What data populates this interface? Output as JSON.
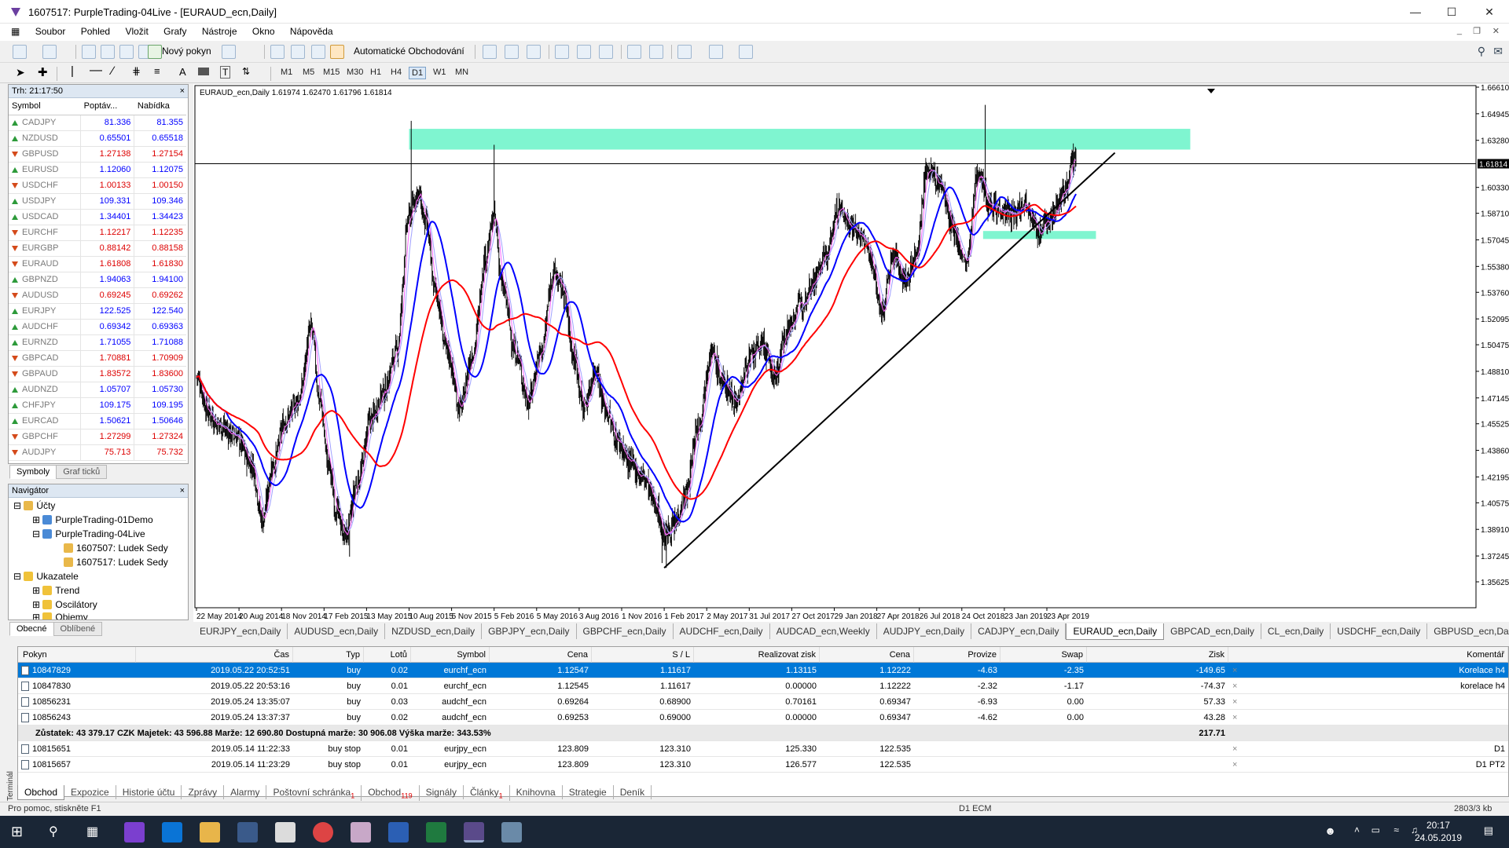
{
  "window": {
    "title": "1607517: PurpleTrading-04Live - [EURAUD_ecn,Daily]"
  },
  "menu": [
    "Soubor",
    "Pohled",
    "Vložit",
    "Grafy",
    "Nástroje",
    "Okno",
    "Nápověda"
  ],
  "toolbar": {
    "new_order": "Nový pokyn",
    "auto_trading": "Automatické Obchodování"
  },
  "timeframes": [
    "M1",
    "M5",
    "M15",
    "M30",
    "H1",
    "H4",
    "D1",
    "W1",
    "MN"
  ],
  "selected_timeframe": "D1",
  "market_watch": {
    "header": "Trh: 21:17:50",
    "columns": [
      "Symbol",
      "Poptáv...",
      "Nabídka"
    ],
    "rows": [
      {
        "symbol": "CADJPY",
        "bid": "81.336",
        "ask": "81.355",
        "dir": "up"
      },
      {
        "symbol": "NZDUSD",
        "bid": "0.65501",
        "ask": "0.65518",
        "dir": "up"
      },
      {
        "symbol": "GBPUSD",
        "bid": "1.27138",
        "ask": "1.27154",
        "dir": "dn"
      },
      {
        "symbol": "EURUSD",
        "bid": "1.12060",
        "ask": "1.12075",
        "dir": "up"
      },
      {
        "symbol": "USDCHF",
        "bid": "1.00133",
        "ask": "1.00150",
        "dir": "dn"
      },
      {
        "symbol": "USDJPY",
        "bid": "109.331",
        "ask": "109.346",
        "dir": "up"
      },
      {
        "symbol": "USDCAD",
        "bid": "1.34401",
        "ask": "1.34423",
        "dir": "up"
      },
      {
        "symbol": "EURCHF",
        "bid": "1.12217",
        "ask": "1.12235",
        "dir": "dn"
      },
      {
        "symbol": "EURGBP",
        "bid": "0.88142",
        "ask": "0.88158",
        "dir": "dn"
      },
      {
        "symbol": "EURAUD",
        "bid": "1.61808",
        "ask": "1.61830",
        "dir": "dn"
      },
      {
        "symbol": "GBPNZD",
        "bid": "1.94063",
        "ask": "1.94100",
        "dir": "up"
      },
      {
        "symbol": "AUDUSD",
        "bid": "0.69245",
        "ask": "0.69262",
        "dir": "dn"
      },
      {
        "symbol": "EURJPY",
        "bid": "122.525",
        "ask": "122.540",
        "dir": "up"
      },
      {
        "symbol": "AUDCHF",
        "bid": "0.69342",
        "ask": "0.69363",
        "dir": "up"
      },
      {
        "symbol": "EURNZD",
        "bid": "1.71055",
        "ask": "1.71088",
        "dir": "up"
      },
      {
        "symbol": "GBPCAD",
        "bid": "1.70881",
        "ask": "1.70909",
        "dir": "dn"
      },
      {
        "symbol": "GBPAUD",
        "bid": "1.83572",
        "ask": "1.83600",
        "dir": "dn"
      },
      {
        "symbol": "AUDNZD",
        "bid": "1.05707",
        "ask": "1.05730",
        "dir": "up"
      },
      {
        "symbol": "CHFJPY",
        "bid": "109.175",
        "ask": "109.195",
        "dir": "up"
      },
      {
        "symbol": "EURCAD",
        "bid": "1.50621",
        "ask": "1.50646",
        "dir": "up"
      },
      {
        "symbol": "GBPCHF",
        "bid": "1.27299",
        "ask": "1.27324",
        "dir": "dn"
      },
      {
        "symbol": "AUDJPY",
        "bid": "75.713",
        "ask": "75.732",
        "dir": "dn"
      }
    ],
    "tabs": [
      "Symboly",
      "Graf ticků"
    ]
  },
  "navigator": {
    "header": "Navigátor",
    "accounts": "Účty",
    "demo": "PurpleTrading-01Demo",
    "live": "PurpleTrading-04Live",
    "acc1": "1607507: Ludek Sedy",
    "acc2": "1607517: Ludek Sedy",
    "indicators": "Ukazatele",
    "trend": "Trend",
    "osc": "Oscilátory",
    "vol": "Objemy",
    "tabs": [
      "Obecné",
      "Oblíbené"
    ]
  },
  "chart": {
    "header": "EURAUD_ecn,Daily  1.61974 1.62470 1.61796 1.61814",
    "price_labels": [
      "1.66610",
      "1.64945",
      "1.63280",
      "1.61814",
      "1.60330",
      "1.58710",
      "1.57045",
      "1.55380",
      "1.53760",
      "1.52095",
      "1.50475",
      "1.48810",
      "1.47145",
      "1.45525",
      "1.43860",
      "1.42195",
      "1.40575",
      "1.38910",
      "1.37245",
      "1.35625"
    ],
    "current_price": "1.61814",
    "date_labels": [
      "22 May 2014",
      "20 Aug 2014",
      "18 Nov 2014",
      "17 Feb 2015",
      "13 May 2015",
      "10 Aug 2015",
      "5 Nov 2015",
      "5 Feb 2016",
      "5 May 2016",
      "3 Aug 2016",
      "1 Nov 2016",
      "1 Feb 2017",
      "2 May 2017",
      "31 Jul 2017",
      "27 Oct 2017",
      "29 Jan 2018",
      "27 Apr 2018",
      "26 Jul 2018",
      "24 Oct 2018",
      "23 Jan 2019",
      "23 Apr 2019"
    ],
    "tabs": [
      "EURJPY_ecn,Daily",
      "AUDUSD_ecn,Daily",
      "NZDUSD_ecn,Daily",
      "GBPJPY_ecn,Daily",
      "GBPCHF_ecn,Daily",
      "AUDCHF_ecn,Daily",
      "AUDCAD_ecn,Weekly",
      "AUDJPY_ecn,Daily",
      "CADJPY_ecn,Daily",
      "EURAUD_ecn,Daily",
      "GBPCAD_ecn,Daily",
      "CL_ecn,Daily",
      "USDCHF_ecn,Daily",
      "GBPUSD_ecn,Daily"
    ],
    "active_tab": "EURAUD_ecn,Daily"
  },
  "terminal": {
    "columns": [
      "Pokyn",
      "Čas",
      "Typ",
      "Lotů",
      "Symbol",
      "Cena",
      "S / L",
      "Realizovat zisk",
      "Cena",
      "Provize",
      "Swap",
      "Zisk",
      "Komentář"
    ],
    "orders": [
      {
        "id": "10847829",
        "time": "2019.05.22 20:52:51",
        "type": "buy",
        "lots": "0.02",
        "symbol": "eurchf_ecn",
        "price": "1.12547",
        "sl": "1.11617",
        "tp": "1.13115",
        "cur": "1.12222",
        "comm": "-4.63",
        "swap": "-2.35",
        "profit": "-149.65",
        "comment": "Korelace h4"
      },
      {
        "id": "10847830",
        "time": "2019.05.22 20:53:16",
        "type": "buy",
        "lots": "0.01",
        "symbol": "eurchf_ecn",
        "price": "1.12545",
        "sl": "1.11617",
        "tp": "0.00000",
        "cur": "1.12222",
        "comm": "-2.32",
        "swap": "-1.17",
        "profit": "-74.37",
        "comment": "korelace h4"
      },
      {
        "id": "10856231",
        "time": "2019.05.24 13:35:07",
        "type": "buy",
        "lots": "0.03",
        "symbol": "audchf_ecn",
        "price": "0.69264",
        "sl": "0.68900",
        "tp": "0.70161",
        "cur": "0.69347",
        "comm": "-6.93",
        "swap": "0.00",
        "profit": "57.33",
        "comment": ""
      },
      {
        "id": "10856243",
        "time": "2019.05.24 13:37:37",
        "type": "buy",
        "lots": "0.02",
        "symbol": "audchf_ecn",
        "price": "0.69253",
        "sl": "0.69000",
        "tp": "0.00000",
        "cur": "0.69347",
        "comm": "-4.62",
        "swap": "0.00",
        "profit": "43.28",
        "comment": ""
      }
    ],
    "balance_text": "Zůstatek: 43 379.17 CZK  Majetek: 43 596.88  Marže: 12 690.80  Dostupná marže: 30 906.08  Výška marže: 343.53%",
    "balance_profit": "217.71",
    "pending": [
      {
        "id": "10815651",
        "time": "2019.05.14 11:22:33",
        "type": "buy stop",
        "lots": "0.01",
        "symbol": "eurjpy_ecn",
        "price": "123.809",
        "sl": "123.310",
        "tp": "125.330",
        "cur": "122.535",
        "comment": "D1"
      },
      {
        "id": "10815657",
        "time": "2019.05.14 11:23:29",
        "type": "buy stop",
        "lots": "0.01",
        "symbol": "eurjpy_ecn",
        "price": "123.809",
        "sl": "123.310",
        "tp": "126.577",
        "cur": "122.535",
        "comment": "D1 PT2"
      }
    ],
    "tabs": [
      "Obchod",
      "Expozice",
      "Historie účtu",
      "Zprávy",
      "Alarmy",
      "Poštovní schránka",
      "Obchod",
      "Signály",
      "Články",
      "Knihovna",
      "Strategie",
      "Deník"
    ],
    "badges": {
      "mail": "1",
      "market": "119",
      "articles": "1"
    },
    "vertical_label": "Terminál"
  },
  "status": {
    "help": "Pro pomoc, stiskněte F1",
    "profile": "D1 ECM",
    "traffic": "2803/3 kb"
  },
  "clock": {
    "time": "20:17",
    "date": "24.05.2019"
  }
}
